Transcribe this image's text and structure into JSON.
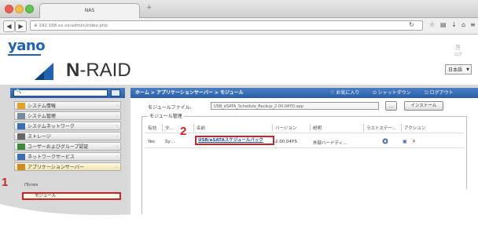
{
  "browser": {
    "tab_title": "NAS",
    "new_tab": "+",
    "url": "⊕ 192.168.xx.xx/admin/index.php",
    "back": "◀",
    "forward": "▶"
  },
  "header": {
    "brand": "yano",
    "product_prefix": "N",
    "product_suffix": "-RAID",
    "logout_label": "ログ",
    "language": "日本語"
  },
  "sidebar": {
    "search_placeholder": "",
    "items": [
      {
        "label": "システム情報",
        "icon": "info-icon",
        "color": "#e8a020"
      },
      {
        "label": "システム管理",
        "icon": "tools-icon",
        "color": "#7a8aa0"
      },
      {
        "label": "システムネットワーク",
        "icon": "network-icon",
        "color": "#3a6fb5"
      },
      {
        "label": "ストレージ",
        "icon": "storage-icon",
        "color": "#666666"
      },
      {
        "label": "ユーザーおよびグループ認証",
        "icon": "users-icon",
        "color": "#3a8a3a"
      },
      {
        "label": "ネットワークサービス",
        "icon": "network-service-icon",
        "color": "#3a6fb5"
      },
      {
        "label": "アプリケーションサーバー",
        "icon": "app-server-icon",
        "color": "#d08a20"
      }
    ],
    "sub_items": [
      "iTunes",
      "モジュール"
    ]
  },
  "main": {
    "breadcrumb": "ホーム > アプリケーションサーバー > モジュール",
    "top_actions": [
      "お気に入り",
      "シャットダウン",
      "ログアウト"
    ],
    "file_label": "モジュールファイル:",
    "file_value": "USB_eSATA_Schedule_Backup_2.00.04YD.app",
    "browse_label": "…",
    "install_label": "インストール",
    "section_title": "モジュール管理",
    "columns": [
      "有効",
      "タ…",
      "名前",
      "バージョン",
      "説明",
      "ラストステー…",
      "アクション"
    ],
    "rows": [
      {
        "enabled": "Yes",
        "type": "Sy…",
        "name": "USB/eSATAスケジュールバック",
        "version": "2.00.04YS",
        "description": "外部ハードディ…"
      }
    ]
  },
  "markers": [
    "1",
    "2"
  ],
  "colors": {
    "accent": "#2a5ea8",
    "highlight": "#d0212a",
    "brand": "#1f62b0"
  }
}
